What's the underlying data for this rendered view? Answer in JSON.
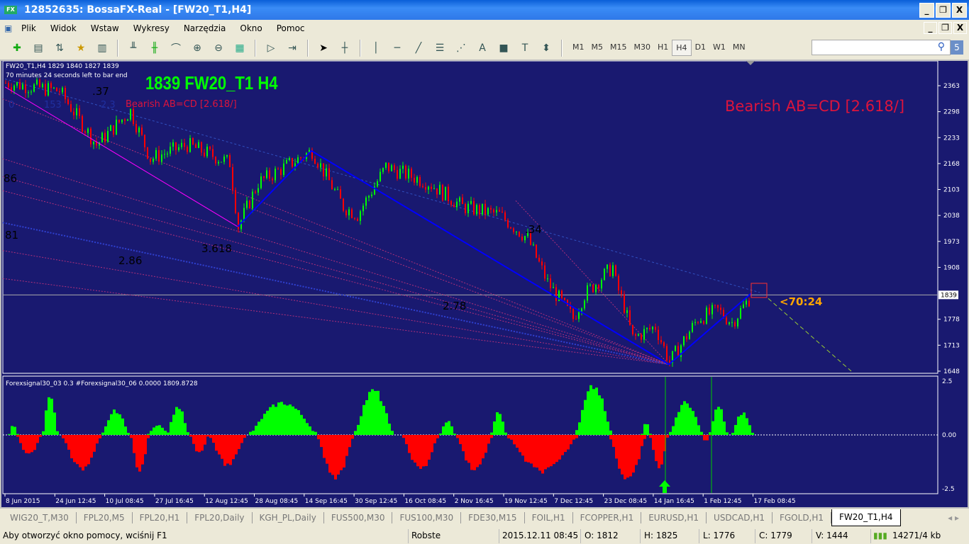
{
  "window": {
    "title": "12852635: BossaFX-Real - [FW20_T1,H4]",
    "logo": "FX"
  },
  "menu": [
    "Plik",
    "Widok",
    "Wstaw",
    "Wykresy",
    "Narzędzia",
    "Okno",
    "Pomoc"
  ],
  "timeframes": [
    "M1",
    "M5",
    "M15",
    "M30",
    "H1",
    "H4",
    "D1",
    "W1",
    "MN"
  ],
  "active_timeframe": "H4",
  "search": {
    "value": "",
    "badge": "5"
  },
  "chart": {
    "info_line": "FW20_T1,H4  1829 1840 1827 1839",
    "timer_line": "70 minutes 24 seconds left to bar end",
    "big_title": "1839 FW20_T1 H4",
    "pattern_small": "Bearish AB=CD [2.618/]",
    "pattern_big": "Bearish AB=CD [2.618/]",
    "countdown": "<70:24",
    "fib_labels": [
      ".37",
      "3.618",
      "2.86",
      "2.78",
      ".34",
      "86",
      "81"
    ],
    "faint_labels": [
      "0",
      "153",
      "2.3"
    ],
    "price_ticks": [
      2363,
      2298,
      2233,
      2168,
      2103,
      2038,
      1973,
      1908,
      1778,
      1713,
      1648
    ],
    "current_price": "1839",
    "time_labels": [
      "8 Jun 2015",
      "24 Jun 12:45",
      "10 Jul 08:45",
      "27 Jul 16:45",
      "12 Aug 12:45",
      "28 Aug 08:45",
      "14 Sep 16:45",
      "30 Sep 12:45",
      "16 Oct 08:45",
      "2 Nov 16:45",
      "19 Nov 12:45",
      "7 Dec 12:45",
      "23 Dec 08:45",
      "14 Jan 16:45",
      "1 Feb 12:45",
      "17 Feb 08:45"
    ],
    "price_path": [
      [
        0,
        2370
      ],
      [
        19,
        2350
      ],
      [
        32,
        2215
      ],
      [
        44,
        2300
      ],
      [
        51,
        2180
      ],
      [
        64,
        2215
      ],
      [
        79,
        2170
      ],
      [
        82,
        2010
      ],
      [
        89,
        2120
      ],
      [
        108,
        2200
      ],
      [
        119,
        2060
      ],
      [
        124,
        2040
      ],
      [
        134,
        2160
      ],
      [
        149,
        2120
      ],
      [
        161,
        2060
      ],
      [
        174,
        2040
      ],
      [
        184,
        1980
      ],
      [
        191,
        1870
      ],
      [
        200,
        1780
      ],
      [
        204,
        1840
      ],
      [
        214,
        1910
      ],
      [
        215,
        1870
      ],
      [
        218,
        1810
      ],
      [
        221,
        1730
      ],
      [
        229,
        1760
      ],
      [
        234,
        1670
      ],
      [
        244,
        1780
      ],
      [
        251,
        1800
      ],
      [
        256,
        1770
      ],
      [
        263,
        1839
      ]
    ],
    "abcd_points": [
      [
        82,
        2010
      ],
      [
        108,
        2200
      ],
      [
        234,
        1665
      ],
      [
        263,
        1843
      ]
    ],
    "colors": {
      "bg": "#191970",
      "up": "#00ff00",
      "down": "#ff0000",
      "abcd": "#0000ff",
      "pattern": "#dc143c",
      "countdown": "#ffa500"
    }
  },
  "indicator": {
    "label": "Forexsignal30_03 0.3  #Forexsignal30_06 0.0000 1809.8728",
    "ticks": [
      "2.5",
      "0.00",
      "-2.5"
    ],
    "humps": [
      [
        1,
        4,
        0.5
      ],
      [
        4,
        12,
        -1
      ],
      [
        13,
        18,
        2
      ],
      [
        20,
        33,
        -1.7
      ],
      [
        34,
        43,
        1.2
      ],
      [
        44,
        50,
        -1.8
      ],
      [
        50,
        57,
        0.5
      ],
      [
        57,
        64,
        1.4
      ],
      [
        65,
        71,
        -0.9
      ],
      [
        72,
        84,
        -1.5
      ],
      [
        86,
        109,
        1.6
      ],
      [
        110,
        122,
        -2.2
      ],
      [
        123,
        136,
        2.2
      ],
      [
        140,
        152,
        -1.7
      ],
      [
        153,
        158,
        0.7
      ],
      [
        159,
        171,
        -1.7
      ],
      [
        171,
        176,
        1.2
      ],
      [
        177,
        201,
        -1.8
      ],
      [
        201,
        213,
        2.4
      ],
      [
        213,
        225,
        -2.3
      ],
      [
        224,
        227,
        0.6
      ],
      [
        227,
        233,
        -1.6
      ],
      [
        234,
        245,
        1.6
      ],
      [
        245,
        248,
        -0.3
      ],
      [
        248,
        254,
        1.4
      ],
      [
        256,
        263,
        1.1
      ]
    ]
  },
  "tabs": [
    "WIG20_T,M30",
    "FPL20,M5",
    "FPL20,H1",
    "FPL20,Daily",
    "KGH_PL,Daily",
    "FUS500,M30",
    "FUS100,M30",
    "FDE30,M15",
    "FOIL,H1",
    "FCOPPER,H1",
    "EURUSD,H1",
    "USDCAD,H1",
    "FGOLD,H1",
    "FW20_T1,H4"
  ],
  "status": {
    "help": "Aby otworzyć okno pomocy, wciśnij F1",
    "profile": "Robste",
    "datetime": "2015.12.11 08:45",
    "open": "O: 1812",
    "high": "H: 1825",
    "low": "L: 1776",
    "close": "C: 1779",
    "volume": "V: 1444",
    "traffic": "14271/4 kb"
  }
}
